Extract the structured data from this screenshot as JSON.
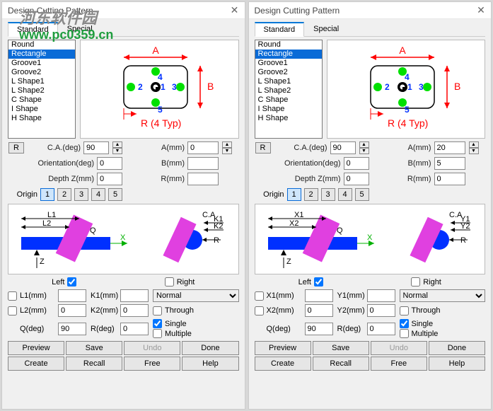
{
  "dialogs": [
    {
      "title": "Design Cutting Pattern",
      "tabs": [
        "Standard",
        "Special"
      ],
      "activeTab": 0,
      "shapes": [
        "Round",
        "Rectangle",
        "Groove1",
        "Groove2",
        "L Shape1",
        "L Shape2",
        "C Shape",
        "I Shape",
        "H Shape"
      ],
      "selectedShape": 1,
      "ca_label": "C.A.(deg)",
      "ca_value": "90",
      "r_button": "R",
      "orient_label": "Orientation(deg)",
      "orient_value": "0",
      "depth_label": "Depth Z(mm)",
      "depth_value": "0",
      "origin_label": "Origin",
      "origins": [
        "1",
        "2",
        "3",
        "4",
        "5"
      ],
      "origin_sel": 0,
      "a_label": "A(mm)",
      "a_value": "0",
      "b_label": "B(mm)",
      "b_value": "",
      "r_label": "R(mm)",
      "r_value": "",
      "left_label": "Left",
      "right_label": "Right",
      "left_checked": true,
      "right_checked": false,
      "k1_label": "K1(mm)",
      "k2_label": "K2(mm)",
      "rdeg_label": "R(deg)",
      "l1_label": "L1(mm)",
      "l2_label": "L2(mm)",
      "q_label": "Q(deg)",
      "l1_value": "",
      "l2_value": "0",
      "q_value": "90",
      "k1_value": "",
      "k2_value": "0",
      "rdeg_value": "0",
      "select_value": "Normal",
      "through": "Through",
      "single": "Single",
      "multiple": "Multiple",
      "through_checked": false,
      "single_checked": true,
      "multiple_checked": false,
      "buttons": [
        "Preview",
        "Save",
        "Undo",
        "Done",
        "Create",
        "Recall",
        "Free",
        "Help"
      ],
      "diagram_letters": {
        "A": "A",
        "B": "B",
        "R": "R (4 Typ)"
      },
      "diag2": {
        "L1": "L1",
        "L2": "L2",
        "Z": "Z",
        "Q": "Q",
        "X": "X",
        "CA": "C.A",
        "K1": "K1",
        "K2": "K2",
        "R": "R"
      }
    },
    {
      "title": "Design Cutting Pattern",
      "tabs": [
        "Standard",
        "Special"
      ],
      "activeTab": 0,
      "shapes": [
        "Round",
        "Rectangle",
        "Groove1",
        "Groove2",
        "L Shape1",
        "L Shape2",
        "C Shape",
        "I Shape",
        "H Shape"
      ],
      "selectedShape": 1,
      "ca_label": "C.A.(deg)",
      "ca_value": "90",
      "r_button": "R",
      "orient_label": "Orientation(deg)",
      "orient_value": "0",
      "depth_label": "Depth Z(mm)",
      "depth_value": "0",
      "origin_label": "Origin",
      "origins": [
        "1",
        "2",
        "3",
        "4",
        "5"
      ],
      "origin_sel": 0,
      "a_label": "A(mm)",
      "a_value": "20",
      "b_label": "B(mm)",
      "b_value": "5",
      "r_label": "R(mm)",
      "r_value": "0",
      "left_label": "Left",
      "right_label": "Right",
      "left_checked": true,
      "right_checked": false,
      "k1_label": "Y1(mm)",
      "k2_label": "Y2(mm)",
      "rdeg_label": "R(deg)",
      "l1_label": "X1(mm)",
      "l2_label": "X2(mm)",
      "q_label": "Q(deg)",
      "l1_value": "",
      "l2_value": "0",
      "q_value": "90",
      "k1_value": "",
      "k2_value": "0",
      "rdeg_value": "0",
      "select_value": "Normal",
      "through": "Through",
      "single": "Single",
      "multiple": "Multiple",
      "through_checked": false,
      "single_checked": true,
      "multiple_checked": false,
      "buttons": [
        "Preview",
        "Save",
        "Undo",
        "Done",
        "Create",
        "Recall",
        "Free",
        "Help"
      ],
      "diagram_letters": {
        "A": "A",
        "B": "B",
        "R": "R (4 Typ)"
      },
      "diag2": {
        "L1": "X1",
        "L2": "X2",
        "Z": "Z",
        "Q": "Q",
        "X": "X",
        "CA": "C.A",
        "K1": "Y1",
        "K2": "Y2",
        "R": "R"
      }
    }
  ],
  "watermark": {
    "line1": "河东软件园",
    "line2": "www.pc0359.cn"
  }
}
